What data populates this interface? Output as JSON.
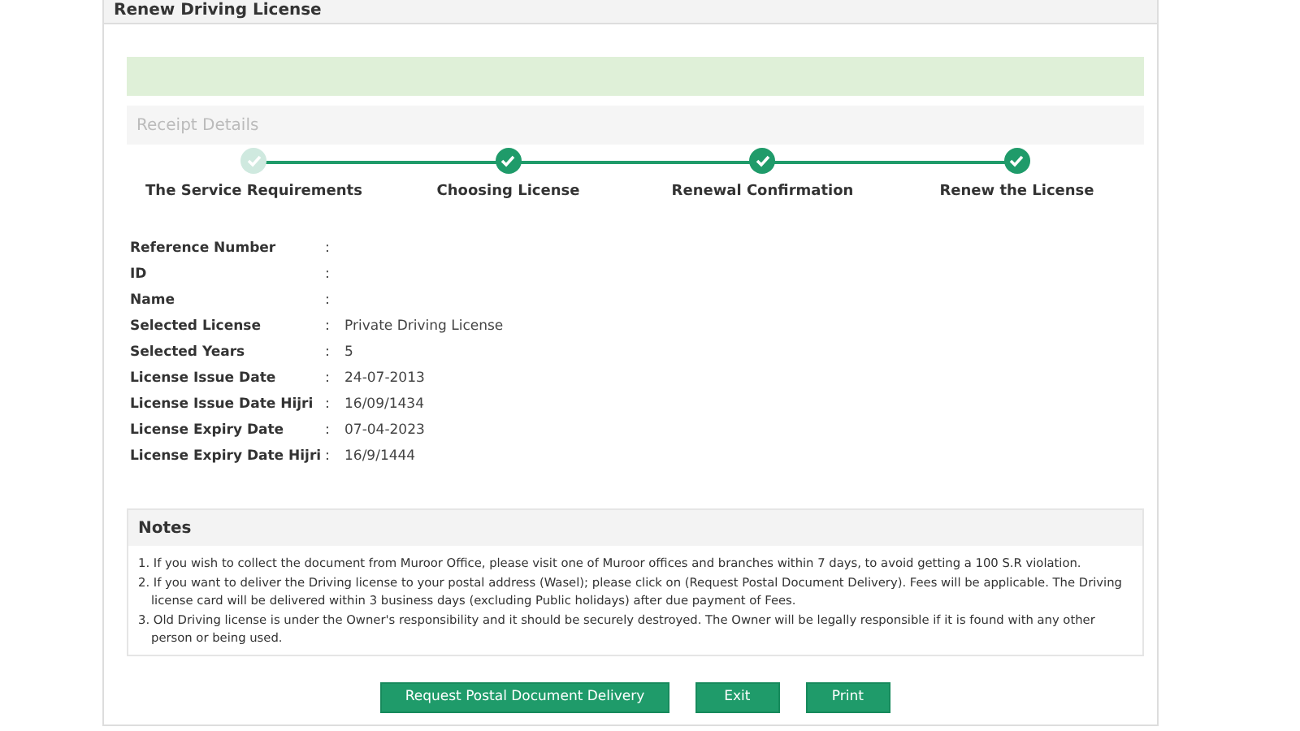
{
  "panel": {
    "title": "Renew Driving License"
  },
  "receipt_section": {
    "title": "Receipt Details"
  },
  "steps": [
    {
      "label": "The Service Requirements",
      "highlighted": false
    },
    {
      "label": "Choosing License",
      "highlighted": true
    },
    {
      "label": "Renewal Confirmation",
      "highlighted": true
    },
    {
      "label": "Renew the License",
      "highlighted": true
    }
  ],
  "fields": [
    {
      "label": "Reference Number",
      "separator": ":"
    },
    {
      "label": "ID",
      "separator": ":"
    },
    {
      "label": "Name",
      "separator": ":"
    },
    {
      "label": "Selected License",
      "separator": ":",
      "value": "Private Driving License"
    },
    {
      "label": "Selected Years",
      "separator": ":",
      "value": "5"
    },
    {
      "label": "License Issue Date",
      "separator": ":",
      "value": "24-07-2013"
    },
    {
      "label": "License Issue Date Hijri",
      "separator": ":",
      "value": "16/09/1434"
    },
    {
      "label": "License Expiry Date",
      "separator": ":",
      "value": "07-04-2023"
    },
    {
      "label": "License Expiry Date Hijri",
      "separator": ":",
      "value": "16/9/1444"
    }
  ],
  "notes": {
    "title": "Notes",
    "items": [
      "1. If you wish to collect the document from Muroor Office, please visit one of Muroor offices and branches within 7 days, to avoid getting a 100 S.R violation.",
      "2. If you want to deliver the Driving license to your postal address (Wasel); please click on (Request Postal Document Delivery). Fees will be applicable. The Driving license card will be delivered within 3 business days (excluding Public holidays) after due payment of Fees.",
      "3. Old Driving license is under the Owner's responsibility and it should be securely destroyed. The Owner will be legally responsible if it is found with any other person or being used."
    ]
  },
  "buttons": [
    "Request Postal Document Delivery",
    "Exit",
    "Print"
  ]
}
